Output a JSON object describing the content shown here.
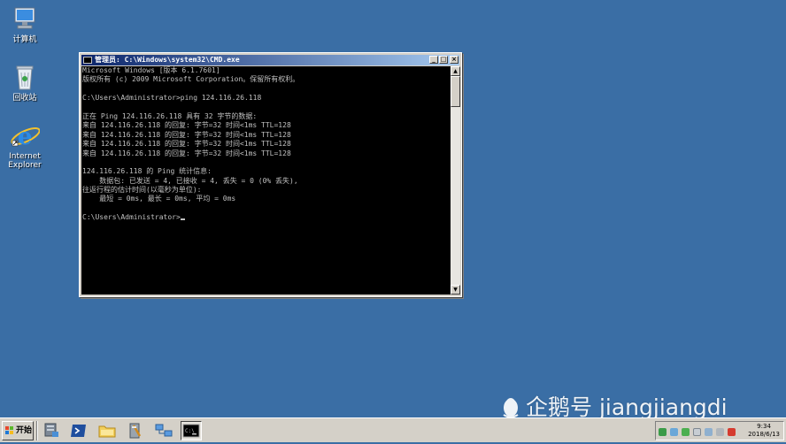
{
  "desktop": {
    "icons": [
      {
        "label": "计算机",
        "icon": "computer-icon"
      },
      {
        "label": "回收站",
        "icon": "recycle-bin-icon"
      },
      {
        "label_line1": "Internet",
        "label_line2": "Explorer",
        "icon": "internet-explorer-icon"
      }
    ],
    "background_color": "#3a6ea5"
  },
  "window": {
    "title": "管理员: C:\\Windows\\system32\\CMD.exe",
    "controls": {
      "minimize": "_",
      "maximize": "□",
      "close": "×"
    },
    "console_lines": [
      "Microsoft Windows [版本 6.1.7601]",
      "版权所有 (c) 2009 Microsoft Corporation。保留所有权利。",
      "",
      "C:\\Users\\Administrator>ping 124.116.26.118",
      "",
      "正在 Ping 124.116.26.118 具有 32 字节的数据:",
      "来自 124.116.26.118 的回复: 字节=32 时间<1ms TTL=128",
      "来自 124.116.26.118 的回复: 字节=32 时间<1ms TTL=128",
      "来自 124.116.26.118 的回复: 字节=32 时间<1ms TTL=128",
      "来自 124.116.26.118 的回复: 字节=32 时间<1ms TTL=128",
      "",
      "124.116.26.118 的 Ping 统计信息:",
      "    数据包: 已发送 = 4, 已接收 = 4, 丢失 = 0 (0% 丢失),",
      "往返行程的估计时间(以毫秒为单位):",
      "    最短 = 0ms, 最长 = 0ms, 平均 = 0ms",
      ""
    ],
    "prompt": "C:\\Users\\Administrator>"
  },
  "taskbar": {
    "start_label": "开始",
    "quicklaunch": [
      "server-manager-icon",
      "powershell-icon",
      "explorer-folder-icon",
      "tools-icon",
      "network-icon",
      "cmd-icon"
    ],
    "clock_time": "9:34",
    "clock_date": "2018/6/13"
  },
  "watermark": {
    "text": "企鹅号 jiangjiangdi"
  }
}
